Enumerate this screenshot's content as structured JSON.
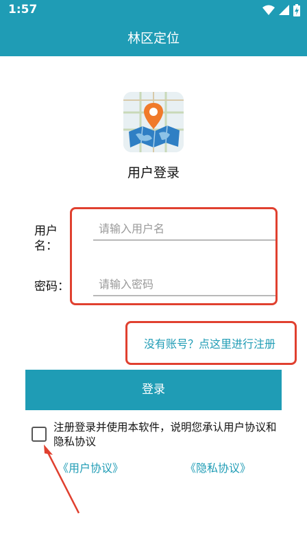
{
  "status_bar": {
    "time": "1:57",
    "icons": [
      "wifi-icon",
      "cell-signal-icon",
      "battery-icon"
    ]
  },
  "app_bar": {
    "title": "林区定位"
  },
  "logo": {
    "icon": "map-pin-logo-icon"
  },
  "login_title": "用户登录",
  "form": {
    "username": {
      "label": "用户\n名：",
      "placeholder": "请输入用户名",
      "value": ""
    },
    "password": {
      "label": "密码：",
      "placeholder": "请输入密码",
      "value": ""
    }
  },
  "register_link": "没有账号？点这里进行注册",
  "login_button": "登录",
  "agreement": {
    "checked": false,
    "text": "注册登录并使用本软件，说明您承认用户协议和隐私协议",
    "user_agreement_link": "《用户协议》",
    "privacy_link": "《隐私协议》"
  },
  "colors": {
    "accent": "#1f9cb5",
    "highlight": "#e0402f"
  }
}
